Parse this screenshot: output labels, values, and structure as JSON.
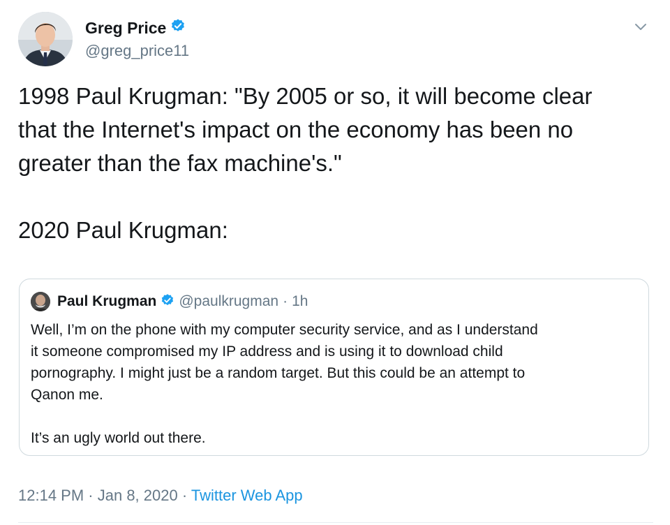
{
  "author": {
    "display_name": "Greg Price",
    "handle": "@greg_price11",
    "verified": true
  },
  "tweet": {
    "text_lines": [
      "1998 Paul Krugman: \"By 2005 or so, it will become clear",
      "that the Internet's impact on the economy has been no",
      "greater than the fax machine's.\""
    ],
    "text_after": "2020 Paul Krugman:"
  },
  "quoted_tweet": {
    "display_name": "Paul Krugman",
    "handle": "@paulkrugman",
    "separator": "·",
    "time": "1h",
    "lines": [
      "Well, I’m on the phone with my computer security service, and as I understand",
      "it someone compromised my IP address and is using it to download child",
      "pornography. I might just be a random target. But this could be an attempt to",
      "Qanon me."
    ],
    "last_line": "It’s an ugly world out there."
  },
  "meta": {
    "time": "12:14 PM",
    "sep1": " · ",
    "date": "Jan 8, 2020",
    "sep2": " · ",
    "source": "Twitter Web App"
  },
  "colors": {
    "verified_badge": "#1da1f2",
    "link": "#1b95e0",
    "secondary_text": "#657786"
  },
  "icons": {
    "verified": "verified-badge-icon",
    "menu": "chevron-down-icon"
  }
}
